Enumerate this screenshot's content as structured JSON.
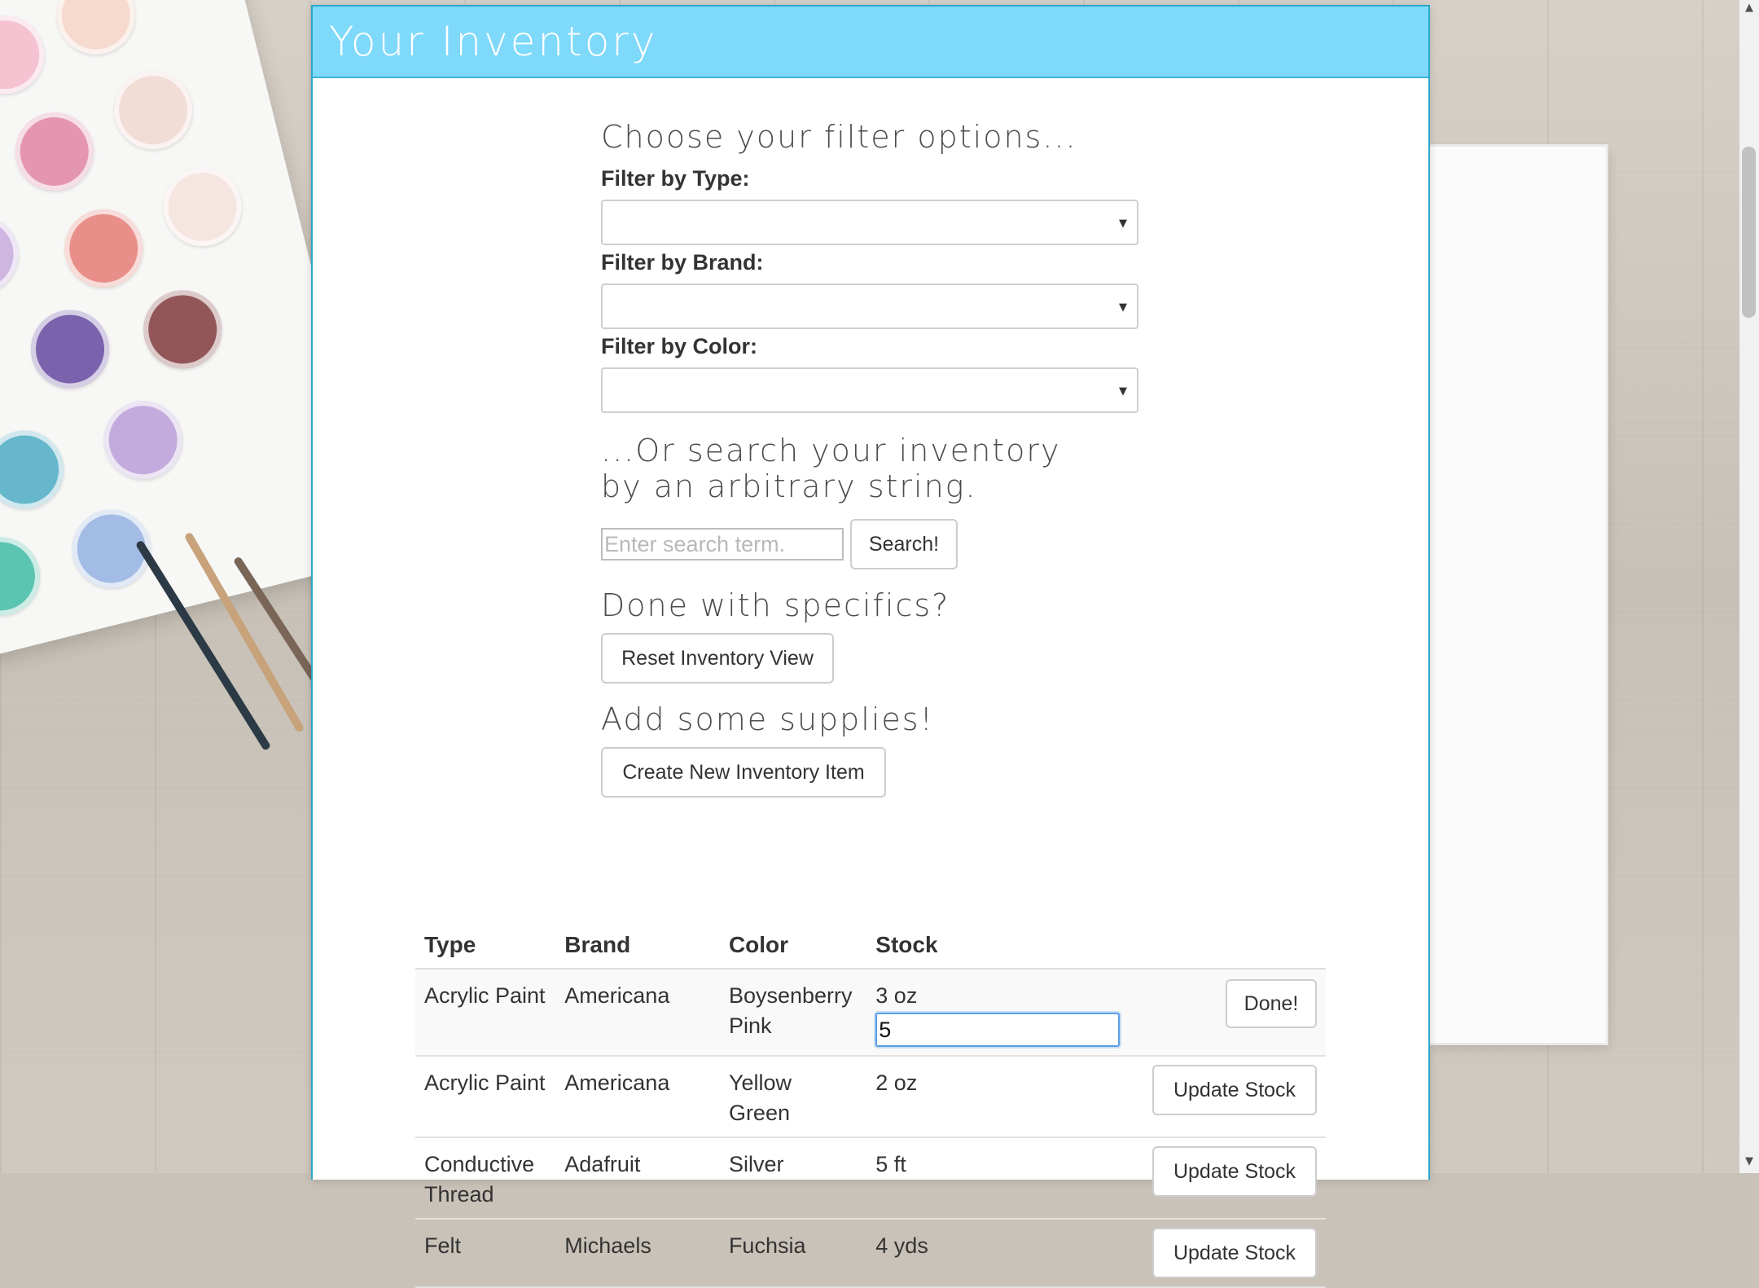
{
  "page": {
    "title": "Your Inventory"
  },
  "filters": {
    "heading": "Choose your filter options...",
    "type_label": "Filter by Type:",
    "type_value": "",
    "brand_label": "Filter by Brand:",
    "brand_value": "",
    "color_label": "Filter by Color:",
    "color_value": ""
  },
  "search": {
    "heading": "...Or search your inventory by an arbitrary string.",
    "placeholder": "Enter search term.",
    "value": "",
    "button_label": "Search!"
  },
  "reset": {
    "heading": "Done with specifics?",
    "button_label": "Reset Inventory View"
  },
  "create": {
    "heading": "Add some supplies!",
    "button_label": "Create New Inventory Item"
  },
  "table": {
    "columns": [
      "Type",
      "Brand",
      "Color",
      "Stock"
    ],
    "rows": [
      {
        "type": "Acrylic Paint",
        "brand": "Americana",
        "color": "Boysenberry Pink",
        "stock": "3 oz",
        "edit_value": "5",
        "action": "Done!"
      },
      {
        "type": "Acrylic Paint",
        "brand": "Americana",
        "color": "Yellow Green",
        "stock": "2 oz",
        "action": "Update Stock"
      },
      {
        "type": "Conductive Thread",
        "brand": "Adafruit",
        "color": "Silver",
        "stock": "5 ft",
        "action": "Update Stock"
      },
      {
        "type": "Felt",
        "brand": "Michaels",
        "color": "Fuchsia",
        "stock": "4 yds",
        "action": "Update Stock"
      }
    ]
  },
  "colors": {
    "header_bg": "#7fd9fb",
    "header_border": "#3bb4d6",
    "focus_border": "#5b9ee6"
  }
}
